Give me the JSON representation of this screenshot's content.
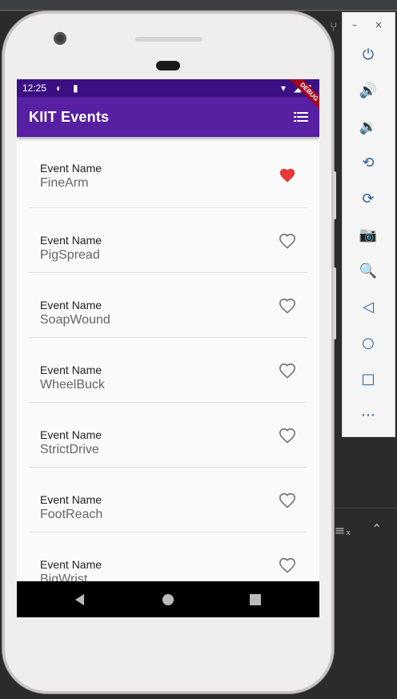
{
  "status_bar": {
    "time": "12:25"
  },
  "app_bar": {
    "title": "KIIT Events"
  },
  "debug_banner": "DEBUG",
  "events": [
    {
      "label": "Event Name",
      "name": "FineArm",
      "favorite": true
    },
    {
      "label": "Event Name",
      "name": "PigSpread",
      "favorite": false
    },
    {
      "label": "Event Name",
      "name": "SoapWound",
      "favorite": false
    },
    {
      "label": "Event Name",
      "name": "WheelBuck",
      "favorite": false
    },
    {
      "label": "Event Name",
      "name": "StrictDrive",
      "favorite": false
    },
    {
      "label": "Event Name",
      "name": "FootReach",
      "favorite": false
    },
    {
      "label": "Event Name",
      "name": "BigWrist",
      "favorite": false
    }
  ],
  "colors": {
    "status_bar": "#3b1083",
    "app_bar": "#571fa1",
    "heart_filled": "#e53935",
    "heart_outline": "#757575"
  },
  "emulator_controls": {
    "minimize": "–",
    "close": "×",
    "icons": [
      "power-icon",
      "volume-up-icon",
      "volume-down-icon",
      "rotate-left-icon",
      "rotate-right-icon",
      "camera-icon",
      "zoom-icon",
      "back-icon",
      "home-icon",
      "overview-icon",
      "more-icon"
    ]
  }
}
